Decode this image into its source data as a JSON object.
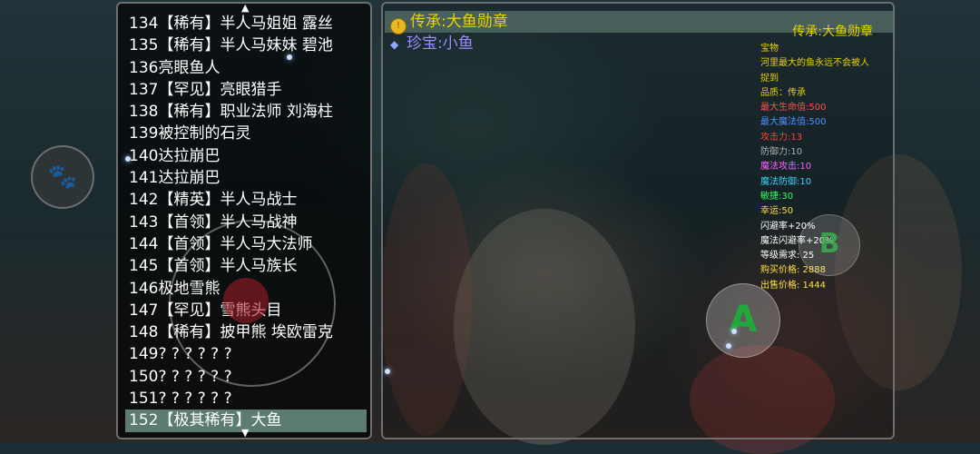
{
  "monster_list": [
    "134【稀有】半人马姐姐 露丝",
    "135【稀有】半人马妹妹 碧池",
    "136亮眼鱼人",
    "137【罕见】亮眼猎手",
    "138【稀有】职业法师 刘海柱",
    "139被控制的石灵",
    "140达拉崩巴",
    "141达拉崩巴",
    "142【精英】半人马战士",
    "143【首领】半人马战神",
    "144【首领】半人马大法师",
    "145【首领】半人马族长",
    "146极地雪熊",
    "147【罕见】雪熊头目",
    "148【稀有】披甲熊 埃欧雷克",
    "149? ? ? ? ? ?",
    "150? ? ? ? ? ?",
    "151? ? ? ? ? ?",
    "152【极其稀有】大鱼"
  ],
  "selected_monster_index": 18,
  "item_list": [
    {
      "icon": "gold-coin-icon",
      "label": "传承:大鱼勋章",
      "color": "#e8d200"
    },
    {
      "icon": "gem-icon",
      "label": "珍宝:小鱼",
      "color": "#9a8cff"
    }
  ],
  "detail": {
    "title": "传承:大鱼勋章",
    "lines": [
      {
        "text": "宝物",
        "color": "#e8d200"
      },
      {
        "text": "河里最大的鱼永远不会被人",
        "color": "#e8d200"
      },
      {
        "text": "捉到",
        "color": "#e8d200"
      },
      {
        "text": "品质：传承",
        "color": "#e8d200"
      },
      {
        "text": "最大生命值:500",
        "color": "#ff5050"
      },
      {
        "text": "最大魔法值:500",
        "color": "#4f8fff"
      },
      {
        "text": "攻击力:13",
        "color": "#ff4040"
      },
      {
        "text": "防御力:10",
        "color": "#b0b0b0"
      },
      {
        "text": "魔法攻击:10",
        "color": "#ff60ff"
      },
      {
        "text": "魔法防御:10",
        "color": "#40d0ff"
      },
      {
        "text": "敏捷:30",
        "color": "#30ff60"
      },
      {
        "text": "幸运:50",
        "color": "#ffe040"
      },
      {
        "text": "闪避率+20%",
        "color": "#ffffff"
      },
      {
        "text": "魔法闪避率+20%",
        "color": "#ffffff"
      },
      {
        "text": "等级需求: 25",
        "color": "#ffffff"
      },
      {
        "text": "购买价格: 2888",
        "color": "#ffe040"
      },
      {
        "text": "出售价格: 1444",
        "color": "#ffe040"
      }
    ]
  },
  "controls": {
    "a_label": "A",
    "b_label": "B",
    "paw_icon": "paw-icon"
  }
}
